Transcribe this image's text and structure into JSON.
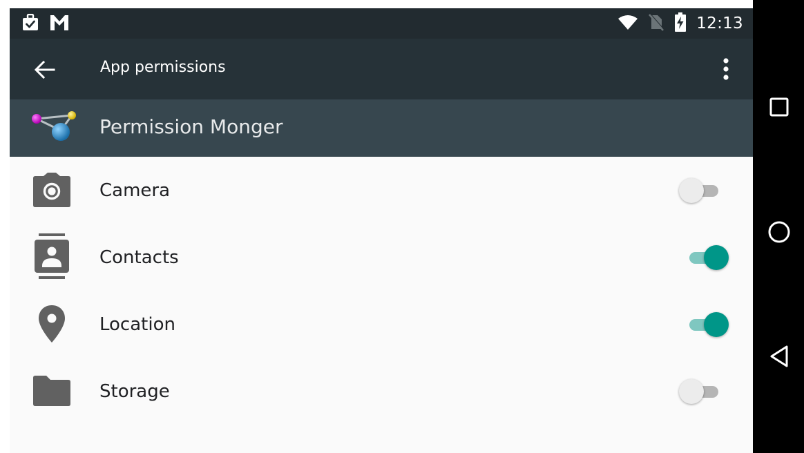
{
  "status_bar": {
    "time": "12:13",
    "icons_left": [
      "work-briefcase-icon",
      "gmail-icon"
    ],
    "icons_right": [
      "wifi-icon",
      "no-sim-icon",
      "battery-charging-icon"
    ]
  },
  "app_bar": {
    "title": "App permissions",
    "back_icon": "arrow-back-icon",
    "overflow_icon": "more-vert-icon"
  },
  "app_header": {
    "name": "Permission Monger",
    "icon": "molecule-app-icon"
  },
  "permissions": [
    {
      "label": "Camera",
      "icon": "camera-icon",
      "enabled": false
    },
    {
      "label": "Contacts",
      "icon": "contacts-icon",
      "enabled": true
    },
    {
      "label": "Location",
      "icon": "location-pin-icon",
      "enabled": true
    },
    {
      "label": "Storage",
      "icon": "folder-icon",
      "enabled": false
    }
  ],
  "nav_bar": {
    "buttons": [
      "recents-square-icon",
      "home-circle-icon",
      "back-triangle-icon"
    ]
  },
  "colors": {
    "status_bar": "#222b30",
    "app_bar": "#263238",
    "app_header": "#37474f",
    "content_bg": "#fafafa",
    "switch_on": "#009688",
    "switch_on_track": "#7fc7c0",
    "icon_gray": "#616161"
  }
}
